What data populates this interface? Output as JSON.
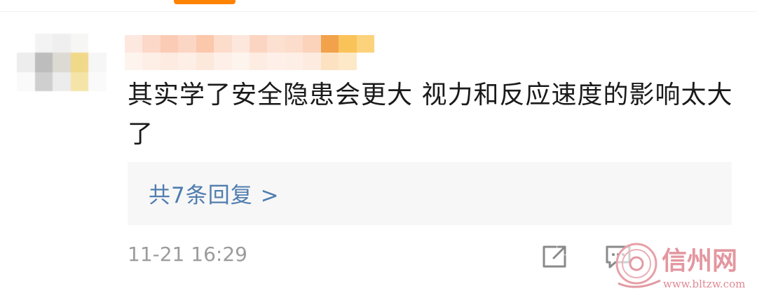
{
  "comment": {
    "text": "其实学了安全隐患会更大  视力和反应速度的影响太大了",
    "timestamp": "11-21 16:29"
  },
  "replies": {
    "label": "共7条回复 >"
  },
  "actions": [
    {
      "icon": "share-icon"
    },
    {
      "icon": "comment-icon"
    }
  ],
  "watermark": {
    "brand": "信州网",
    "url": "www.bltzw.com"
  },
  "colors": {
    "tab_accent": "#ff8200",
    "link": "#507daf",
    "muted": "#9b9b9b",
    "reply_bg": "#f7f7f7"
  }
}
